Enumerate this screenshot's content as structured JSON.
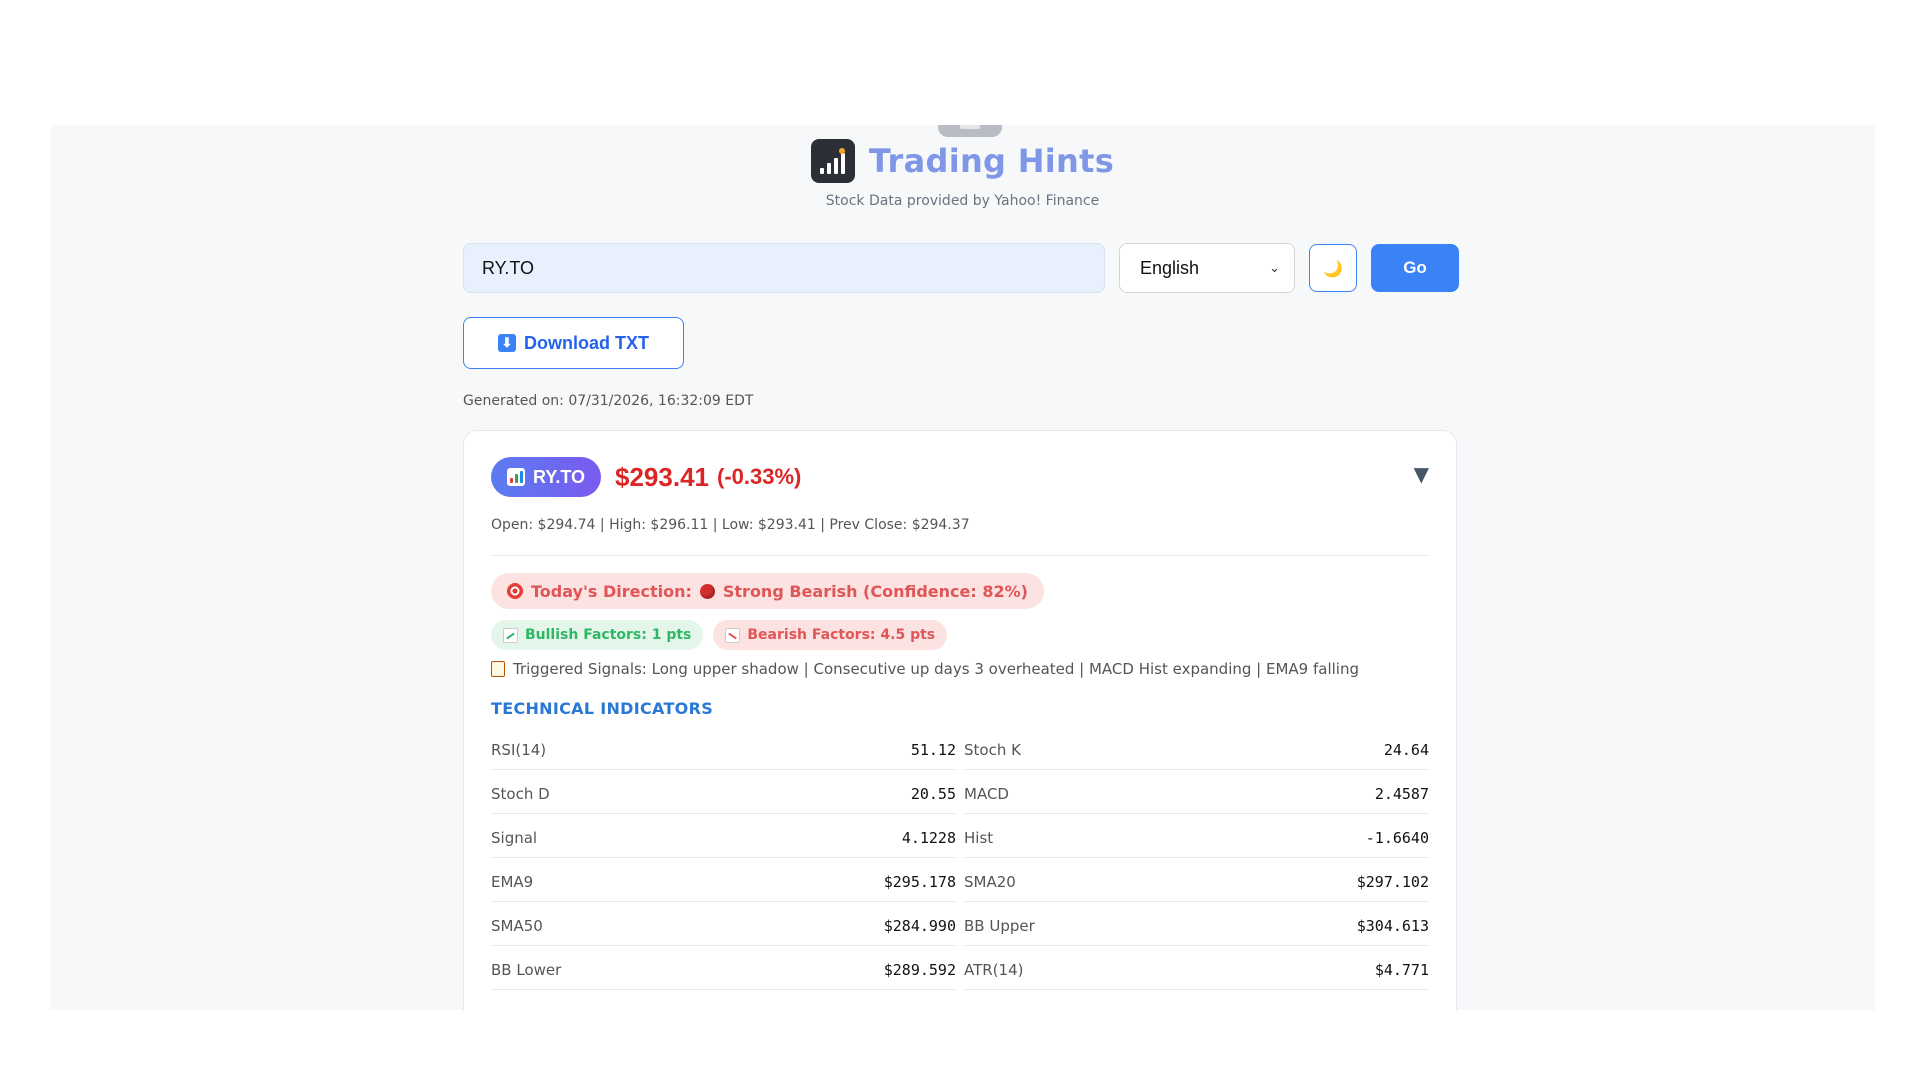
{
  "header": {
    "title": "Trading Hints",
    "subtitle": "Stock Data provided by Yahoo! Finance"
  },
  "search": {
    "ticker_value": "RY.TO",
    "language": "English",
    "theme_icon": "🌙",
    "go_label": "Go"
  },
  "download": {
    "icon": "⬇",
    "label": "Download TXT"
  },
  "generated": "Generated on: 07/31/2026, 16:32:09 EDT",
  "card": {
    "ticker": "RY.TO",
    "price": "$293.41",
    "change": "(-0.33%)",
    "collapse_icon": "▼",
    "ohlc": "Open: $294.74 | High: $296.11 | Low: $293.41 | Prev Close: $294.37",
    "direction_label": "Today's Direction:",
    "direction_value": "Strong Bearish (Confidence: 82%)",
    "bullish": "Bullish Factors: 1 pts",
    "bearish": "Bearish Factors: 4.5 pts",
    "signals": "Triggered Signals: Long upper shadow | Consecutive up days 3 overheated | MACD Hist expanding | EMA9 falling",
    "indicators_title": "TECHNICAL INDICATORS",
    "indicators": [
      {
        "label": "RSI(14)",
        "value": "51.12"
      },
      {
        "label": "Stoch K",
        "value": "24.64"
      },
      {
        "label": "Stoch D",
        "value": "20.55"
      },
      {
        "label": "MACD",
        "value": "2.4587"
      },
      {
        "label": "Signal",
        "value": "4.1228"
      },
      {
        "label": "Hist",
        "value": "-1.6640"
      },
      {
        "label": "EMA9",
        "value": "$295.178"
      },
      {
        "label": "SMA20",
        "value": "$297.102"
      },
      {
        "label": "SMA50",
        "value": "$284.990"
      },
      {
        "label": "BB Upper",
        "value": "$304.613"
      },
      {
        "label": "BB Lower",
        "value": "$289.592"
      },
      {
        "label": "ATR(14)",
        "value": "$4.771"
      }
    ]
  },
  "colors": {
    "accent": "#3b82f6",
    "bearish": "#dc2626",
    "bullish": "#2fb766",
    "title": "#7f97e6"
  }
}
